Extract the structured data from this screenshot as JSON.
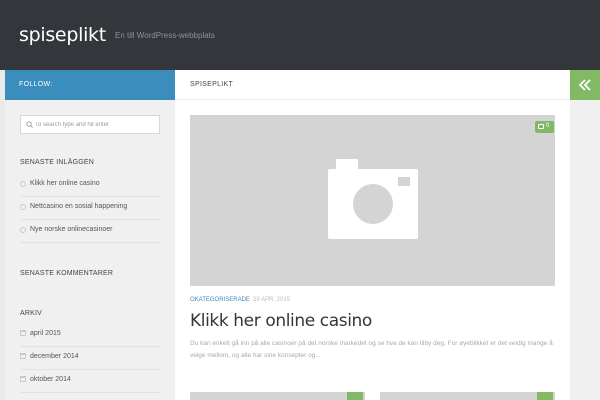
{
  "header": {
    "site_title": "spiseplikt",
    "site_description": "En till WordPress-webbplats"
  },
  "sidebar": {
    "follow_label": "FOLLOW:",
    "search": {
      "placeholder": "To search type and hit enter"
    },
    "recent_posts": {
      "title": "SENASTE INLÄGGEN",
      "items": [
        "Klikk her online casino",
        "Nettcasino en sosial happening",
        "Nye norske onlinecasinoer"
      ]
    },
    "recent_comments": {
      "title": "SENASTE KOMMENTARER"
    },
    "archive": {
      "title": "ARKIV",
      "items": [
        "april 2015",
        "december 2014",
        "oktober 2014"
      ]
    }
  },
  "main": {
    "heading": "SPISEPLIKT",
    "post": {
      "comment_count": "0",
      "category": "OKATEGORISERADE",
      "date": "29 APR, 2015",
      "title": "Klikk her online casino",
      "excerpt": "Du kan enkelt gå inn på alle casinoer på det norske markedet og se hva de kan tilby deg. For øyeblikket er det veldig mange å velge mellom, og alle har sine konsepter og..."
    }
  },
  "colors": {
    "header_bg": "#33363b",
    "accent_blue": "#3b8dbd",
    "accent_green": "#82b965",
    "placeholder_gray": "#d4d4d4"
  },
  "icons": {
    "collapse": "double-chevron-left-icon",
    "search": "search-icon",
    "comment": "comment-bubble-icon",
    "thumbnail": "camera-icon"
  }
}
